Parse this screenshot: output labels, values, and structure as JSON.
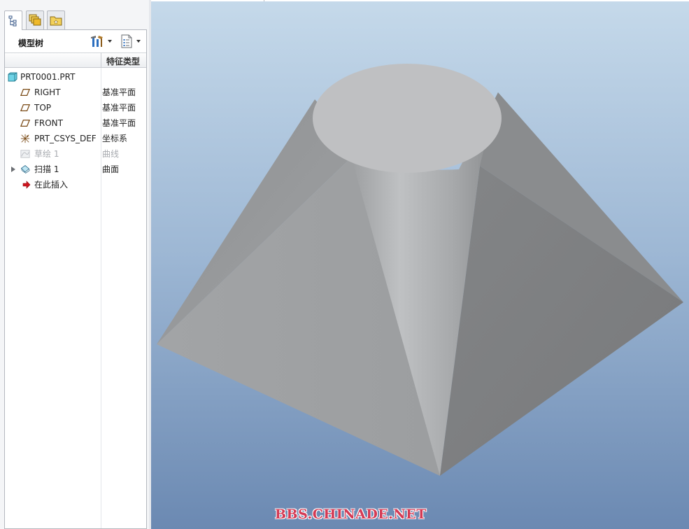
{
  "panel": {
    "tabs": [
      {
        "name": "model-tree",
        "icon": "model-tree-icon"
      },
      {
        "name": "layers",
        "icon": "layers-icon"
      },
      {
        "name": "favorites",
        "icon": "favorites-folder-icon"
      }
    ],
    "title": "模型树",
    "settings_icon": "tree-settings-icon",
    "show_icon": "tree-show-icon",
    "column_header": "特征类型"
  },
  "tree": {
    "root": {
      "label": "PRT0001.PRT",
      "icon": "part-icon"
    },
    "items": [
      {
        "label": "RIGHT",
        "type": "基准平面",
        "icon": "datum-plane-icon"
      },
      {
        "label": "TOP",
        "type": "基准平面",
        "icon": "datum-plane-icon"
      },
      {
        "label": "FRONT",
        "type": "基准平面",
        "icon": "datum-plane-icon"
      },
      {
        "label": "PRT_CSYS_DEF",
        "type": "坐标系",
        "icon": "csys-icon"
      },
      {
        "label": "草绘 1",
        "type": "曲线",
        "icon": "sketch-icon",
        "suppressed": true
      },
      {
        "label": "扫描 1",
        "type": "曲面",
        "icon": "sweep-icon",
        "expandable": true
      },
      {
        "label": "在此插入",
        "type": "",
        "icon": "insert-here-arrow-icon"
      }
    ]
  },
  "viewport": {
    "watermark": "BBS.CHINADE.NET",
    "colors": {
      "bg_top": "#c5d9ea",
      "bg_bottom": "#6b89b2",
      "model_light": "#b9bbbd",
      "model_dark": "#7a7c7e",
      "watermark": "#d43a54"
    }
  }
}
